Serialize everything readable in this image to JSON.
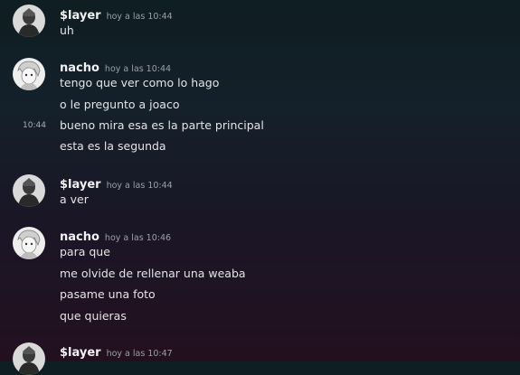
{
  "messages": [
    {
      "author": "$layer",
      "time": "hoy a las 10:44",
      "lines": [
        "uh"
      ]
    },
    {
      "author": "nacho",
      "time": "hoy a las 10:44",
      "lines": [
        "tengo que ver como lo hago",
        "o le pregunto a joaco",
        "bueno mira esa es la parte principal",
        "esta es la segunda"
      ],
      "hover_time": "10:44"
    },
    {
      "author": "$layer",
      "time": "hoy a las 10:44",
      "lines": [
        "a ver"
      ]
    },
    {
      "author": "nacho",
      "time": "hoy a las 10:46",
      "lines": [
        "para que",
        "me olvide de rellenar una weaba",
        "pasame una foto",
        "que quieras"
      ]
    },
    {
      "author": "$layer",
      "time": "hoy a las 10:47",
      "lines": []
    }
  ],
  "avatars": {
    "$layer": "layer-avatar-icon",
    "nacho": "nacho-avatar-icon"
  }
}
